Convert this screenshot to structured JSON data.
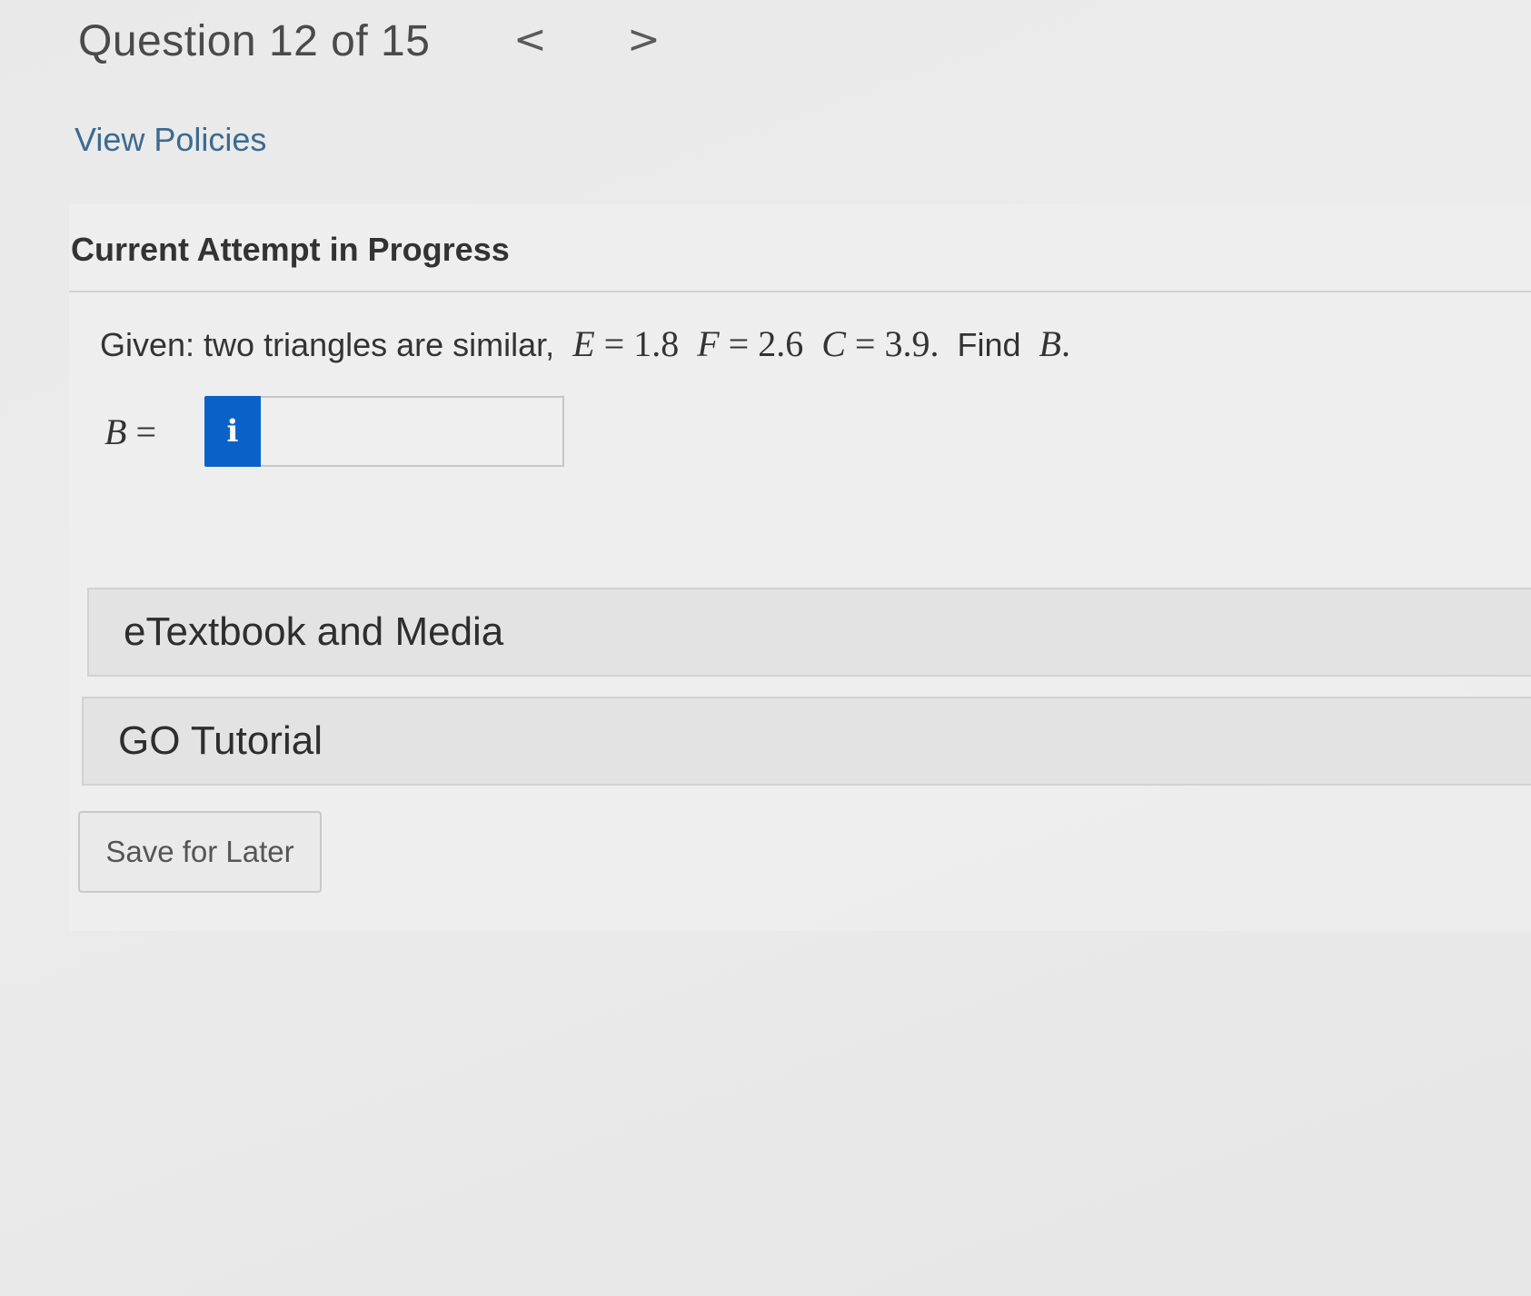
{
  "header": {
    "title": "Question 12 of 15",
    "prev_icon": "chevron-left-icon",
    "prev_glyph": "<",
    "next_icon": "chevron-right-icon",
    "next_glyph": ">"
  },
  "links": {
    "view_policies": "View Policies"
  },
  "attempt": {
    "heading": "Current Attempt in Progress"
  },
  "question": {
    "prefix": "Given: two triangles are similar,",
    "e_var": "E",
    "e_val": "= 1.8",
    "f_var": "F",
    "f_val": "= 2.6",
    "c_var": "C",
    "c_val": "= 3.9.",
    "find": "Find",
    "find_var": "B",
    "find_end": "."
  },
  "answer": {
    "label_var": "B",
    "label_eq": "=",
    "info_icon": "info-icon",
    "info_glyph": "i",
    "value": "",
    "accent_color": "#0a62c8"
  },
  "sections": {
    "etextbook": "eTextbook and Media",
    "go_tutorial": "GO Tutorial"
  },
  "actions": {
    "save_for_later": "Save for Later"
  }
}
